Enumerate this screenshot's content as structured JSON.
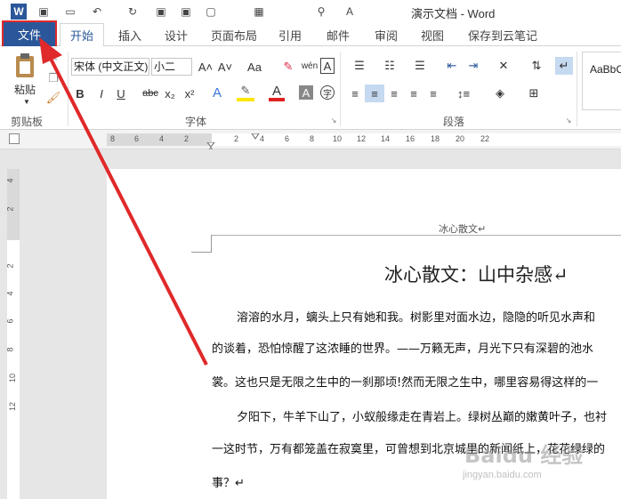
{
  "window": {
    "title": "演示文档 - Word"
  },
  "quick_access": [
    {
      "icon": "word-logo-icon",
      "glyph": "W"
    },
    {
      "icon": "save-icon",
      "glyph": "▣"
    },
    {
      "icon": "open-folder-icon",
      "glyph": "▭"
    },
    {
      "icon": "undo-icon",
      "glyph": "↶"
    },
    {
      "icon": "redo-icon",
      "glyph": "↻"
    },
    {
      "icon": "save-as-icon",
      "glyph": "▣"
    },
    {
      "icon": "save-pdf-icon",
      "glyph": "▣"
    },
    {
      "icon": "print-preview-icon",
      "glyph": "▢"
    },
    {
      "icon": "table-icon",
      "glyph": "▦"
    },
    {
      "icon": "find-icon",
      "glyph": "⚲"
    },
    {
      "icon": "font-size-icon",
      "glyph": "A"
    }
  ],
  "tabs": [
    "文件",
    "开始",
    "插入",
    "设计",
    "页面布局",
    "引用",
    "邮件",
    "审阅",
    "视图",
    "保存到云笔记"
  ],
  "ribbon": {
    "clipboard": {
      "label": "剪贴板",
      "paste": "粘贴"
    },
    "font": {
      "label": "字体",
      "font_name": "宋体 (中文正文)",
      "font_size": "小二",
      "bold": "B",
      "italic": "I",
      "underline": "U",
      "strike": "abc",
      "sub": "x₂",
      "sup": "x²",
      "grow": "A˄",
      "shrink": "A˅",
      "case": "Aa",
      "pinyin": "wén",
      "border_char": "A"
    },
    "paragraph": {
      "label": "段落"
    },
    "styles": {
      "preview": "AaBbC"
    }
  },
  "ruler": {
    "h_ticks": [
      "8",
      "6",
      "4",
      "2",
      "2",
      "4",
      "6",
      "8",
      "10",
      "12",
      "14",
      "16",
      "18",
      "20",
      "22"
    ],
    "v_ticks": [
      "4",
      "2",
      "2",
      "4",
      "6",
      "8",
      "10",
      "12"
    ]
  },
  "document": {
    "header": "冰心散文↵",
    "title": "冰心散文：山中杂感↵",
    "lines": [
      "溶溶的水月，螭头上只有她和我。树影里对面水边，隐隐的听见水声和",
      "的谈着，恐怕惊醒了这浓睡的世界。——万籁无声，月光下只有深碧的池水",
      "裳。这也只是无限之生中的一刹那顷!然而无限之生中，哪里容易得这样的一",
      "夕阳下，牛羊下山了，小蚁般缘走在青岩上。绿树丛巅的嫩黄叶子，也衬",
      "一这时节，万有都笼盖在寂寞里，可曾想到北京城里的新闻纸上，花花绿绿的",
      "事？↵"
    ]
  },
  "watermark": {
    "text": "Baidu 经验",
    "sub": "jingyan.baidu.com"
  },
  "colors": {
    "file_tab": "#2b579a",
    "highlight_box": "#e0292a",
    "arrow": "#e0292a"
  }
}
